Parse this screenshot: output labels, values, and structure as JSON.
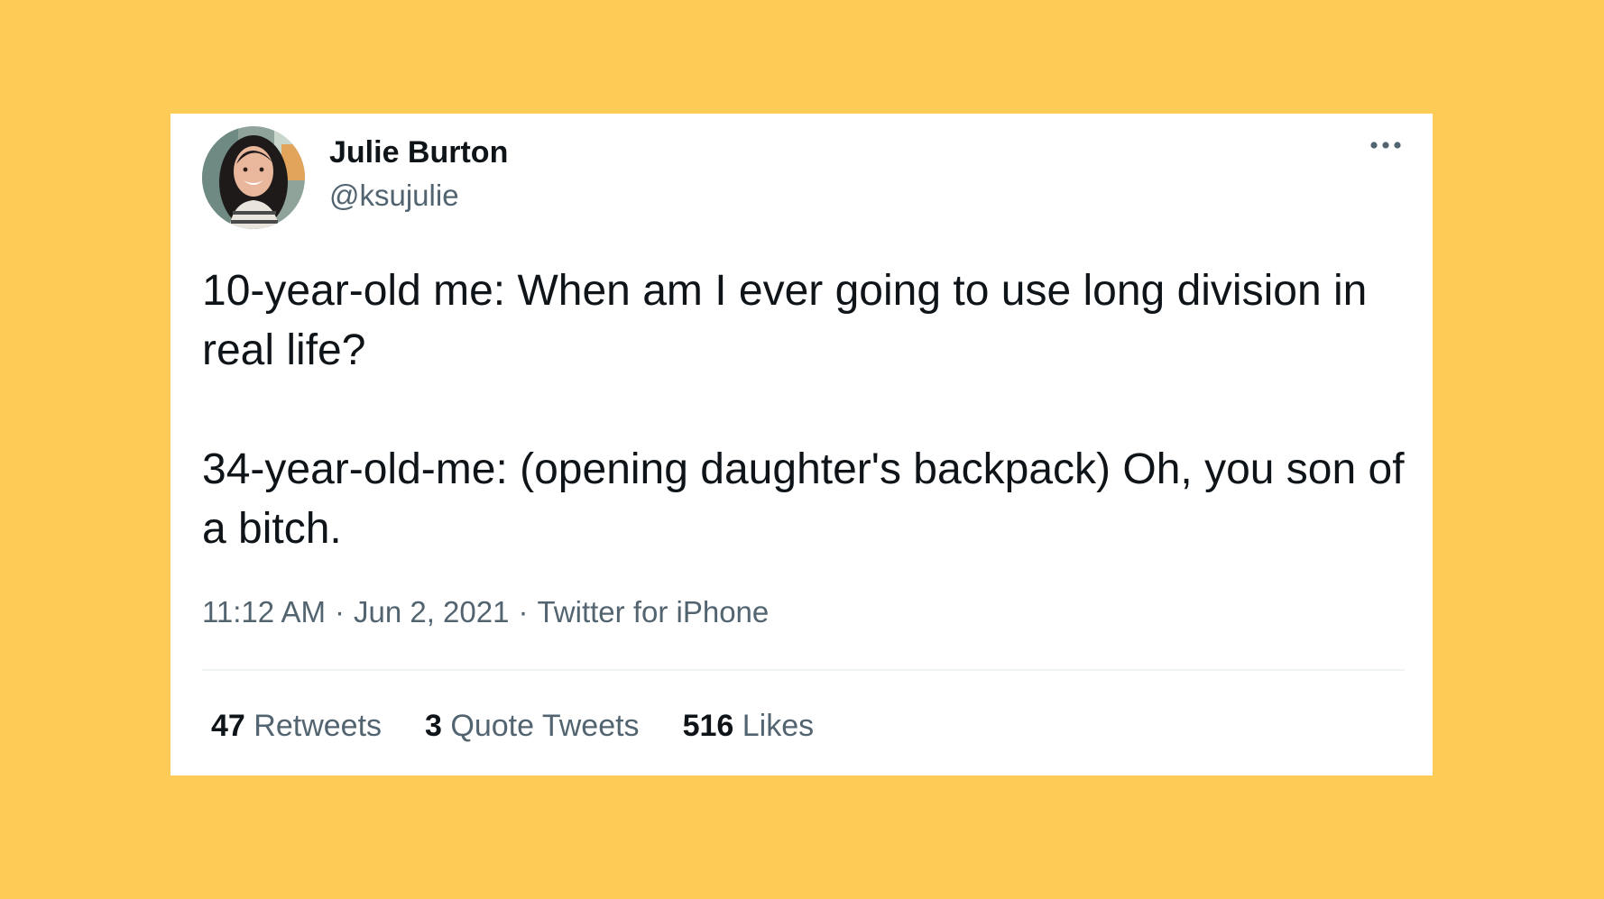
{
  "colors": {
    "background": "#FECB57",
    "card": "#FFFFFF",
    "primary_text": "#0F1419",
    "secondary_text": "#536471",
    "divider": "#EFF3F4"
  },
  "tweet": {
    "author": {
      "name": "Julie Burton",
      "handle": "@ksujulie",
      "avatar_icon": "profile-photo"
    },
    "more_icon": "more-horizontal-icon",
    "text": {
      "line1": "10-year-old me: When am I ever going to use long division in real life?",
      "line2": "34-year-old-me: (opening daughter's backpack) Oh, you son of a bitch."
    },
    "meta": {
      "time": "11:12 AM",
      "sep1": "·",
      "date": "Jun 2, 2021",
      "sep2": "·",
      "source": "Twitter for iPhone"
    },
    "stats": {
      "retweets": {
        "count": "47",
        "label": "Retweets"
      },
      "quotes": {
        "count": "3",
        "label": "Quote Tweets"
      },
      "likes": {
        "count": "516",
        "label": "Likes"
      }
    }
  }
}
